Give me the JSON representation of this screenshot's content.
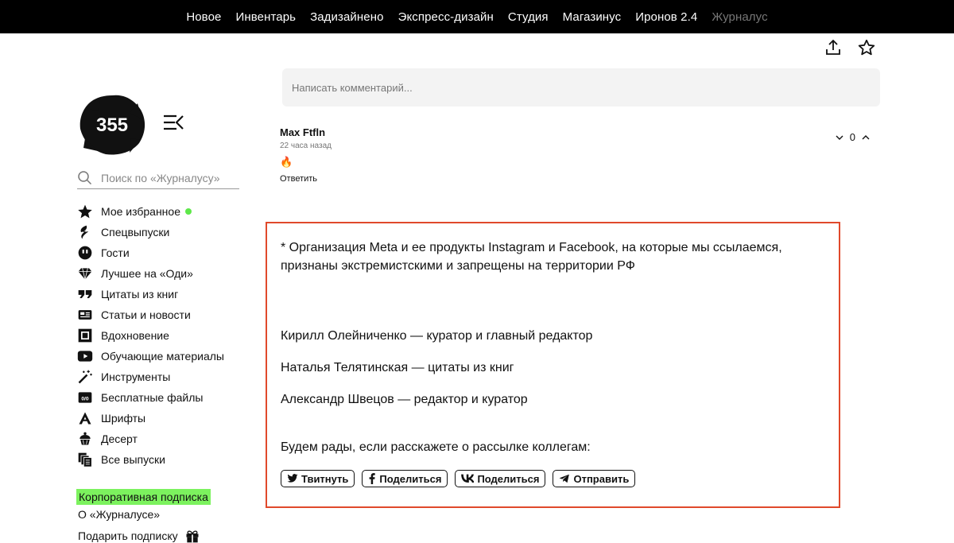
{
  "topnav": {
    "items": [
      {
        "label": "Новое"
      },
      {
        "label": "Инвентарь"
      },
      {
        "label": "Задизайнено"
      },
      {
        "label": "Экспресс-дизайн"
      },
      {
        "label": "Студия"
      },
      {
        "label": "Магазинус"
      },
      {
        "label": "Иронов 2.4"
      },
      {
        "label": "Журналус"
      }
    ]
  },
  "header": {
    "share_icon": "upload-share-icon",
    "favorite_icon": "star-outline-icon"
  },
  "logo": {
    "text": "355"
  },
  "search": {
    "placeholder": "Поиск по «Журналусу»"
  },
  "sidebar": {
    "items": [
      {
        "label": "Мое избранное",
        "icon": "star-icon"
      },
      {
        "label": "Спецвыпуски",
        "icon": "lightning-icon"
      },
      {
        "label": "Гости",
        "icon": "smiley-face-icon"
      },
      {
        "label": "Лучшее на «Оди»",
        "icon": "diamond-icon"
      },
      {
        "label": "Цитаты из книг",
        "icon": "quote-icon"
      },
      {
        "label": "Статьи и новости",
        "icon": "newspaper-icon"
      },
      {
        "label": "Вдохновение",
        "icon": "frame-icon"
      },
      {
        "label": "Обучающие материалы",
        "icon": "play-icon"
      },
      {
        "label": "Инструменты",
        "icon": "magic-wand-icon"
      },
      {
        "label": "Бесплатные файлы",
        "icon": "free-files-icon"
      },
      {
        "label": "Шрифты",
        "icon": "font-a-icon"
      },
      {
        "label": "Десерт",
        "icon": "cupcake-icon"
      },
      {
        "label": "Все выпуски",
        "icon": "stack-icon"
      }
    ],
    "favorite_dot_color": "#5ee84a",
    "corporate": "Корпоративная подписка",
    "about": "О «Журналусе»",
    "gift": "Подарить подписку"
  },
  "comments": {
    "input_placeholder": "Написать комментарий...",
    "list": [
      {
        "author": "Max Ftfln",
        "time": "22 часа назад",
        "body": "🔥",
        "reply": "Ответить",
        "score": "0"
      }
    ]
  },
  "footer_block": {
    "border_color": "#e0492b",
    "notice": "* Организация Meta и ее продукты Instagram и Facebook, на которые мы ссылаемся, признаны экстремистскими и запрещены на территории РФ",
    "credits": [
      "Кирилл Олейниченко — куратор и главный редактор",
      "Наталья Телятинская — цитаты из книг",
      "Александр Швецов — редактор и куратор"
    ],
    "cta": "Будем рады, если расскажете о рассылке коллегам:",
    "share_buttons": [
      {
        "label": "Твитнуть",
        "icon": "twitter-icon"
      },
      {
        "label": "Поделиться",
        "icon": "facebook-icon"
      },
      {
        "label": "Поделиться",
        "icon": "vk-icon"
      },
      {
        "label": "Отправить",
        "icon": "telegram-icon"
      }
    ]
  }
}
